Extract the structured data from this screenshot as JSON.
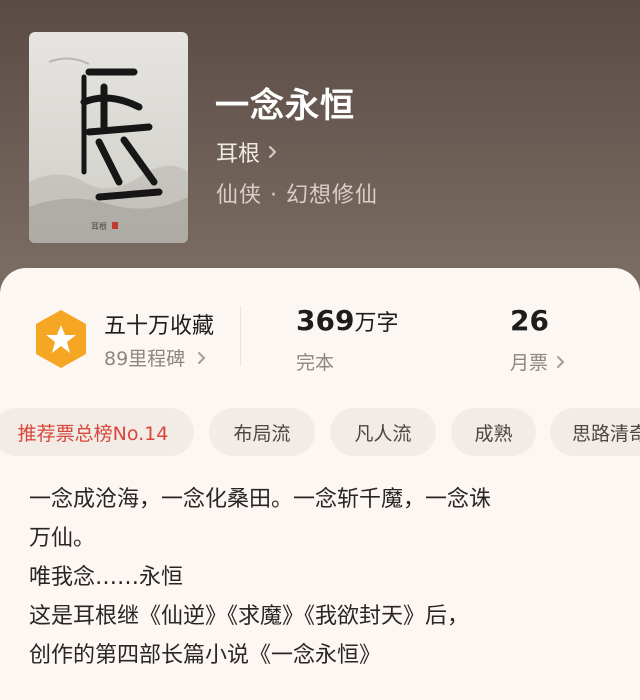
{
  "book": {
    "title": "一念永恒",
    "author": "耳根",
    "genre": "仙侠 · 幻想修仙",
    "cover_calligraphy": "一念永恒",
    "cover_author": "耳根"
  },
  "stats": {
    "favorites_label": "五十万收藏",
    "milestones_label": "89里程碑",
    "word_count_number": "369",
    "word_count_unit": "万字",
    "status": "完本",
    "monthly_tickets_number": "26",
    "monthly_tickets_label": "月票"
  },
  "tags": [
    "推荐票总榜No.14",
    "布局流",
    "凡人流",
    "成熟",
    "思路清奇"
  ],
  "description": [
    "一念成沧海，一念化桑田。一念斩千魔，一念诛",
    "万仙。",
    "唯我念……永恒",
    "这是耳根继《仙逆》《求魔》《我欲封天》后，",
    "创作的第四部长篇小说《一念永恒》"
  ],
  "colors": {
    "accent_red": "#d8473b",
    "badge_orange": "#f5a623",
    "panel_bg": "#fdf7f3"
  }
}
